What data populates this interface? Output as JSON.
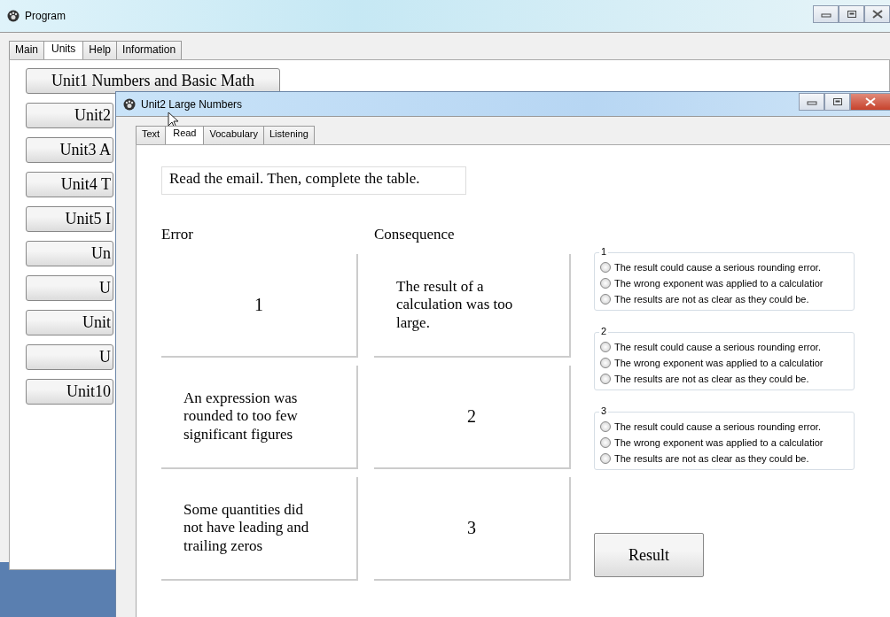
{
  "main_window": {
    "title": "Program",
    "tabs": [
      {
        "label": "Main",
        "selected": false
      },
      {
        "label": "Units",
        "selected": true
      },
      {
        "label": "Help",
        "selected": false
      },
      {
        "label": "Information",
        "selected": false
      }
    ],
    "unit_buttons": [
      "Unit1 Numbers and Basic Math",
      "Unit2",
      "Unit3 A",
      "Unit4 T",
      "Unit5 I",
      "Un",
      "U",
      "Unit",
      "U",
      "Unit10"
    ]
  },
  "unit_window": {
    "title": "Unit2 Large Numbers",
    "tabs": [
      {
        "label": "Text",
        "selected": false
      },
      {
        "label": "Read",
        "selected": true
      },
      {
        "label": "Vocabulary",
        "selected": false
      },
      {
        "label": "Listening",
        "selected": false
      }
    ],
    "instruction": "Read the email. Then, complete the table.",
    "headers": [
      "Error",
      "Consequence"
    ],
    "rows": [
      [
        {
          "kind": "number",
          "text": "1"
        },
        {
          "kind": "text",
          "text": "The result of a calculation was too large."
        }
      ],
      [
        {
          "kind": "text",
          "text": "An expression was rounded to too few significant figures"
        },
        {
          "kind": "number",
          "text": "2"
        }
      ],
      [
        {
          "kind": "text",
          "text": "Some quantities did not have leading and trailing zeros"
        },
        {
          "kind": "number",
          "text": "3"
        }
      ]
    ],
    "choice_groups": [
      {
        "label": "1",
        "options": [
          {
            "text": "The result could cause a serious rounding error.",
            "selected": false
          },
          {
            "text": "The wrong exponent was applied to a calculatior",
            "selected": false
          },
          {
            "text": "The results are not as clear as they could be.",
            "selected": false
          }
        ]
      },
      {
        "label": "2",
        "options": [
          {
            "text": "The result could cause a serious rounding error.",
            "selected": false
          },
          {
            "text": "The wrong exponent was applied to a calculatior",
            "selected": false
          },
          {
            "text": "The results are not as clear as they could be.",
            "selected": false
          }
        ]
      },
      {
        "label": "3",
        "options": [
          {
            "text": "The result could cause a serious rounding error.",
            "selected": false
          },
          {
            "text": "The wrong exponent was applied to a calculatior",
            "selected": false
          },
          {
            "text": "The results are not as clear as they could be.",
            "selected": false
          }
        ]
      }
    ],
    "result_button": "Result"
  }
}
